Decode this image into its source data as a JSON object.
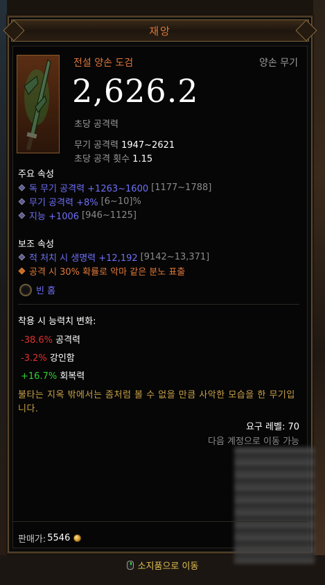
{
  "tooltip": {
    "title": "재앙",
    "item_type": "전설 양손 도검",
    "item_slot": "양손 무기",
    "dps_value": "2,626.2",
    "dps_label": "초당 공격력",
    "weapon_damage_label": "무기 공격력",
    "weapon_damage_value": "1947~2621",
    "attack_speed_label": "초당 공격 횟수",
    "attack_speed_value": "1.15"
  },
  "primary": {
    "heading": "주요 속성",
    "items": [
      {
        "text": "독 무기 공격력 +1263~1600",
        "range": "[1177~1788]"
      },
      {
        "text": "무기 공격력 +8%",
        "range": "[6~10]%"
      },
      {
        "text": "지능 +1006",
        "range": "[946~1125]"
      }
    ]
  },
  "secondary": {
    "heading": "보조 속성",
    "items": [
      {
        "text": "적 처치 시 생명력 +12,192",
        "range": "[9142~13,371]"
      },
      {
        "text": "공격 시 30% 확률로 악마 같은 분노 표출",
        "range": ""
      }
    ]
  },
  "socket": {
    "label": "빈 홈"
  },
  "changes": {
    "heading": "착용 시 능력치 변화:",
    "items": [
      {
        "value": "-38.6%",
        "label": "공격력",
        "kind": "neg"
      },
      {
        "value": "-3.2%",
        "label": "강인함",
        "kind": "neg"
      },
      {
        "value": "+16.7%",
        "label": "회복력",
        "kind": "pos"
      }
    ]
  },
  "flavor": "불타는 지옥 밖에서는 좀처럼 볼 수 없을 만큼 사악한 모습을 한 무기입니다.",
  "requirement": "요구 레벨: 70",
  "account_bound": "다음 계정으로 이동 가능",
  "price": {
    "label": "판매가:",
    "amount": "5546"
  },
  "hint": {
    "label": "소지품으로 이동"
  },
  "colors": {
    "legendary": "#e07838",
    "magic": "#6f6ff6",
    "negative": "#e03030",
    "positive": "#30d030",
    "flavor": "#c8a048"
  }
}
